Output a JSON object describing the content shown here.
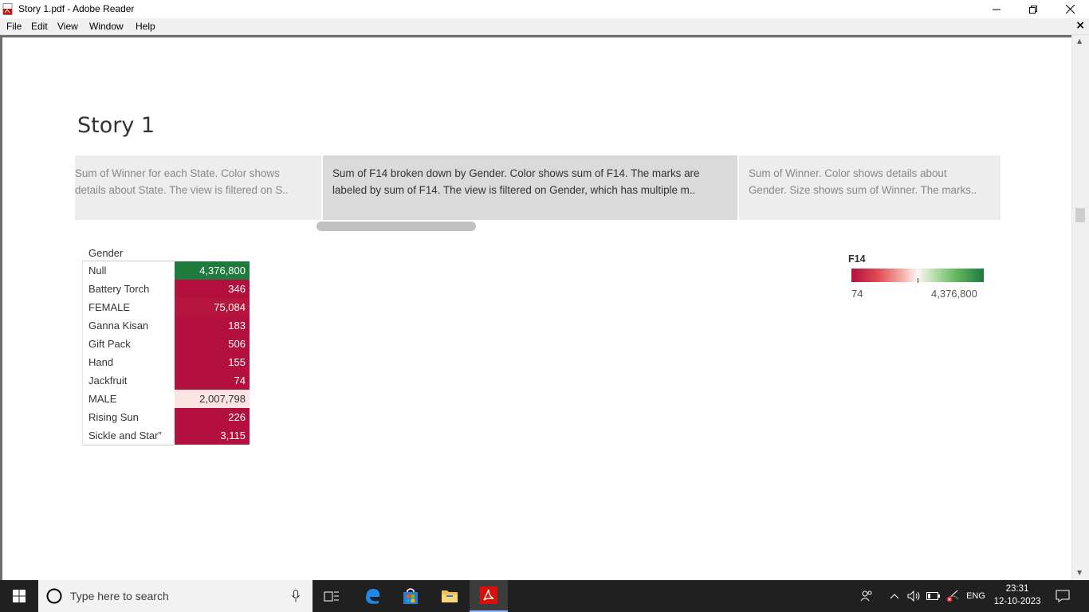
{
  "window": {
    "title": "Story 1.pdf - Adobe Reader"
  },
  "menu": {
    "items": [
      "File",
      "Edit",
      "View",
      "Window",
      "Help"
    ]
  },
  "story": {
    "title": "Story 1",
    "points": [
      {
        "line1": "Sum of Winner for each State.  Color shows",
        "line2": "details about State. The view is filtered on S.."
      },
      {
        "line1": "Sum of F14 broken down by Gender.  Color shows sum of F14.  The marks are",
        "line2": "labeled by sum of F14. The view is filtered on Gender, which has multiple m.."
      },
      {
        "line1": "Sum of Winner.  Color shows details about",
        "line2": "Gender.  Size shows sum of Winner.  The marks.."
      }
    ],
    "active_point": 1
  },
  "table": {
    "column_header": "Gender",
    "rows": [
      {
        "label": "Null",
        "value": "4,376,800",
        "color": "#1f7a3e",
        "text_color": "#ffffff"
      },
      {
        "label": "Battery Torch",
        "value": "346",
        "color": "#b3103f",
        "text_color": "#ffffff"
      },
      {
        "label": "FEMALE",
        "value": "75,084",
        "color": "#b5153f",
        "text_color": "#ffffff"
      },
      {
        "label": "Ganna Kisan",
        "value": "183",
        "color": "#b3103f",
        "text_color": "#ffffff"
      },
      {
        "label": "Gift Pack",
        "value": "506",
        "color": "#b3103f",
        "text_color": "#ffffff"
      },
      {
        "label": "Hand",
        "value": "155",
        "color": "#b3103f",
        "text_color": "#ffffff"
      },
      {
        "label": "Jackfruit",
        "value": "74",
        "color": "#b3103f",
        "text_color": "#ffffff"
      },
      {
        "label": "MALE",
        "value": "2,007,798",
        "color": "#fbe3e1",
        "text_color": "#333333"
      },
      {
        "label": "Rising Sun",
        "value": "226",
        "color": "#b3103f",
        "text_color": "#ffffff"
      },
      {
        "label": "Sickle and Star”",
        "value": "3,115",
        "color": "#b3103f",
        "text_color": "#ffffff"
      }
    ]
  },
  "legend": {
    "title": "F14",
    "min": "74",
    "max": "4,376,800"
  },
  "taskbar": {
    "search_placeholder": "Type here to search",
    "language": "ENG",
    "time": "23:31",
    "date": "12-10-2023"
  }
}
